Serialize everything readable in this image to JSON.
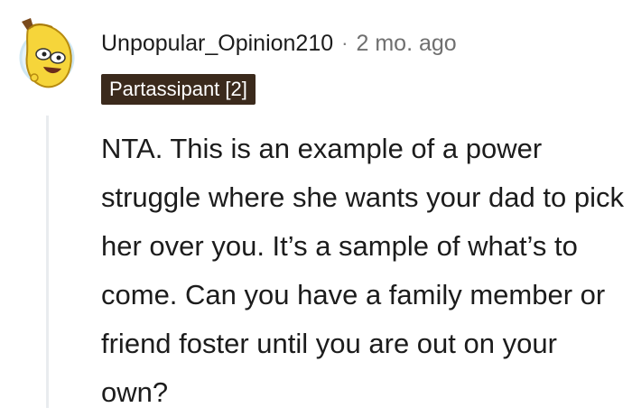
{
  "comment": {
    "author": "Unpopular_Opinion210",
    "separator": "·",
    "timestamp": "2 mo. ago",
    "flair": "Partassipant [2]",
    "avatar_icon": "banana-mascot-icon",
    "body": "NTA. This is an example of a power struggle where she wants your dad to pick her over you. It’s a sample of what’s to come. Can you have a family member or friend foster until you are out on your own?"
  },
  "colors": {
    "background": "#ffffff",
    "text": "#1c1c1c",
    "meta_text": "#6f6f6f",
    "flair_background": "#3b2a1c",
    "flair_text": "#ffffff",
    "thread_line": "#e9ecef",
    "avatar_ring": "#cfe7f3",
    "banana_yellow": "#f6d53a"
  }
}
